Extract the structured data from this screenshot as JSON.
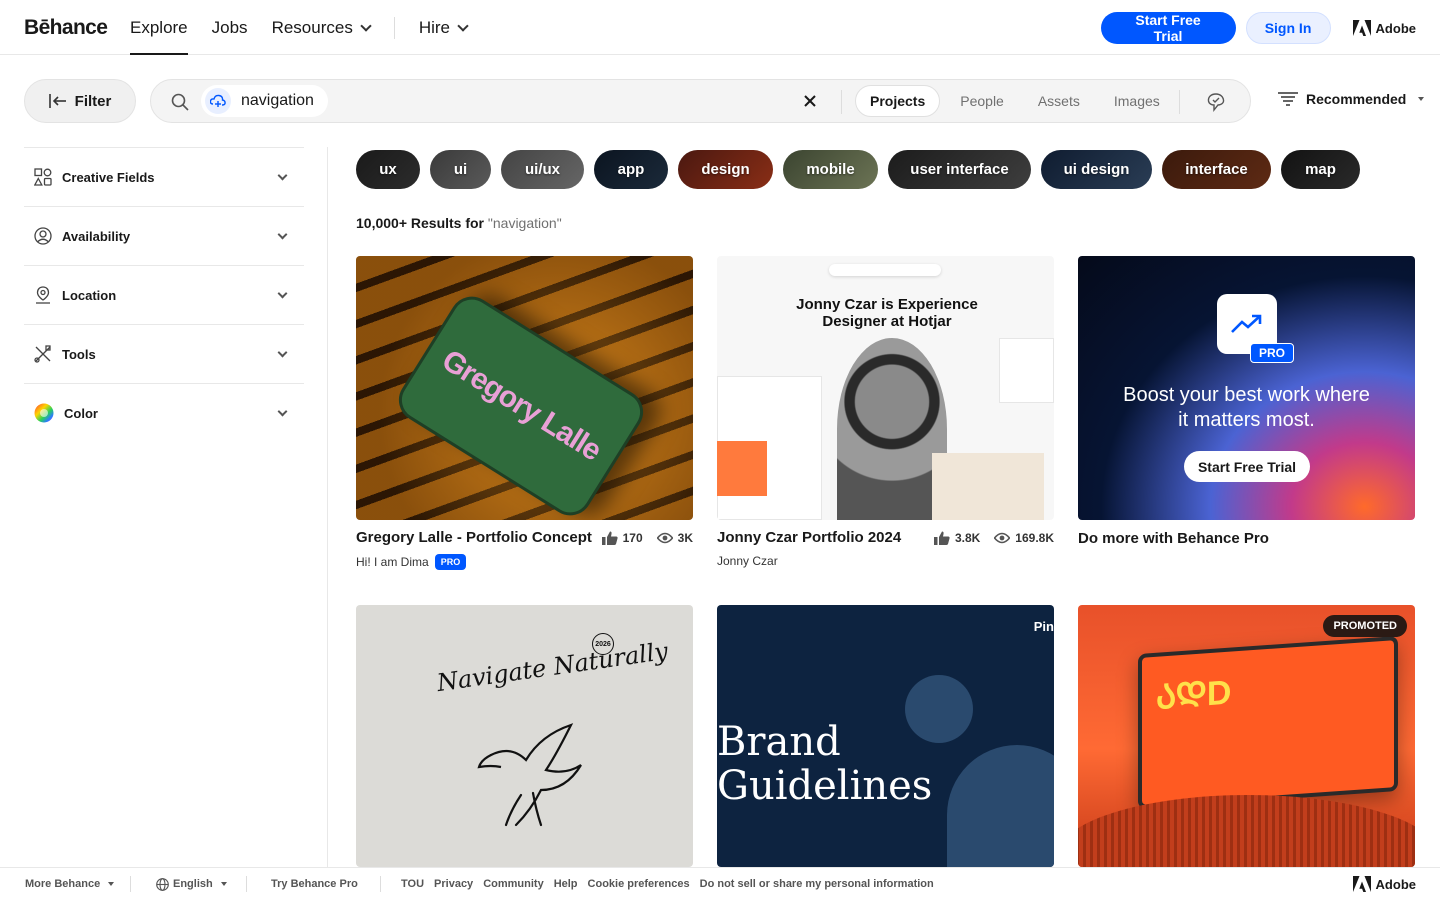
{
  "header": {
    "logo": "Bēhance",
    "nav": [
      {
        "label": "Explore",
        "active": true
      },
      {
        "label": "Jobs"
      },
      {
        "label": "Resources"
      },
      {
        "label": "Hire"
      }
    ],
    "start_trial": "Start Free Trial",
    "sign_in": "Sign In",
    "adobe": "Adobe"
  },
  "search": {
    "filter_label": "Filter",
    "query": "navigation",
    "tabs": [
      "Projects",
      "People",
      "Assets",
      "Images"
    ],
    "active_tab": "Projects",
    "sort_label": "Recommended"
  },
  "sidebar": {
    "items": [
      {
        "label": "Creative Fields",
        "icon": "shapes-icon"
      },
      {
        "label": "Availability",
        "icon": "person-circle-icon"
      },
      {
        "label": "Location",
        "icon": "location-pin-icon"
      },
      {
        "label": "Tools",
        "icon": "tools-icon"
      },
      {
        "label": "Color",
        "icon": "color-wheel-icon"
      }
    ]
  },
  "tags": [
    "ux",
    "ui",
    "ui/ux",
    "app",
    "design",
    "mobile",
    "user interface",
    "ui design",
    "interface",
    "map"
  ],
  "results": {
    "count": "10,000+ Results for",
    "query": "\"navigation\""
  },
  "cards": [
    {
      "title": "Gregory Lalle - Portfolio Concept",
      "author": "Hi! I am Dima",
      "pro": "PRO",
      "likes": "170",
      "views": "3K",
      "art_text": "Gregory Lalle"
    },
    {
      "title": "Jonny Czar Portfolio 2024",
      "author": "Jonny Czar",
      "likes": "3.8K",
      "views": "169.8K",
      "art_text": "Jonny Czar is Experience Designer at Hotjar"
    },
    {
      "title": "Do more with Behance Pro",
      "promo_headline": "Boost your best work where it matters most.",
      "promo_button": "Start Free Trial",
      "pro": "PRO"
    },
    {
      "art_text": "Navigate Naturally",
      "art_year": "2026"
    },
    {
      "art_text": "Brand Guidelines",
      "art_brand": "Pin"
    },
    {
      "badge": "PROMOTED",
      "art_text": "ᲐᲓD"
    }
  ],
  "footer": {
    "more": "More Behance",
    "language": "English",
    "try_pro": "Try Behance Pro",
    "links": [
      "TOU",
      "Privacy",
      "Community",
      "Help",
      "Cookie preferences",
      "Do not sell or share my personal information"
    ],
    "adobe": "Adobe"
  },
  "colors": {
    "brand_blue": "#0057ff",
    "text": "#191919"
  }
}
